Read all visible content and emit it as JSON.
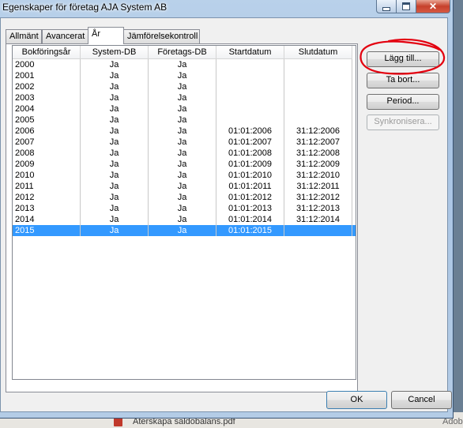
{
  "window": {
    "title": "Egenskaper för företag AJA System AB"
  },
  "tabs": [
    {
      "label": "Allmänt"
    },
    {
      "label": "Avancerat"
    },
    {
      "label": "År"
    },
    {
      "label": "Jämförelsekontroll"
    }
  ],
  "list": {
    "columns": [
      "Bokföringsår",
      "System-DB",
      "Företags-DB",
      "Startdatum",
      "Slutdatum"
    ],
    "rows": [
      [
        "2000",
        "Ja",
        "Ja",
        "",
        ""
      ],
      [
        "2001",
        "Ja",
        "Ja",
        "",
        ""
      ],
      [
        "2002",
        "Ja",
        "Ja",
        "",
        ""
      ],
      [
        "2003",
        "Ja",
        "Ja",
        "",
        ""
      ],
      [
        "2004",
        "Ja",
        "Ja",
        "",
        ""
      ],
      [
        "2005",
        "Ja",
        "Ja",
        "",
        ""
      ],
      [
        "2006",
        "Ja",
        "Ja",
        "01:01:2006",
        "31:12:2006"
      ],
      [
        "2007",
        "Ja",
        "Ja",
        "01:01:2007",
        "31:12:2007"
      ],
      [
        "2008",
        "Ja",
        "Ja",
        "01:01:2008",
        "31:12:2008"
      ],
      [
        "2009",
        "Ja",
        "Ja",
        "01:01:2009",
        "31:12:2009"
      ],
      [
        "2010",
        "Ja",
        "Ja",
        "01:01:2010",
        "31:12:2010"
      ],
      [
        "2011",
        "Ja",
        "Ja",
        "01:01:2011",
        "31:12:2011"
      ],
      [
        "2012",
        "Ja",
        "Ja",
        "01:01:2012",
        "31:12:2012"
      ],
      [
        "2013",
        "Ja",
        "Ja",
        "01:01:2013",
        "31:12:2013"
      ],
      [
        "2014",
        "Ja",
        "Ja",
        "01:01:2014",
        "31:12:2014"
      ],
      [
        "2015",
        "Ja",
        "Ja",
        "01:01:2015",
        ""
      ]
    ],
    "selected_row": 15
  },
  "buttons": {
    "add": "Lägg till...",
    "remove": "Ta bort...",
    "period": "Period...",
    "sync": "Synkronisera...",
    "ok": "OK",
    "cancel": "Cancel"
  },
  "background": {
    "file_text": "Återskapa saldobalans.pdf",
    "right_text": "Adob"
  },
  "colors": {
    "selection": "#3399ff",
    "annotation": "#e3000f"
  }
}
